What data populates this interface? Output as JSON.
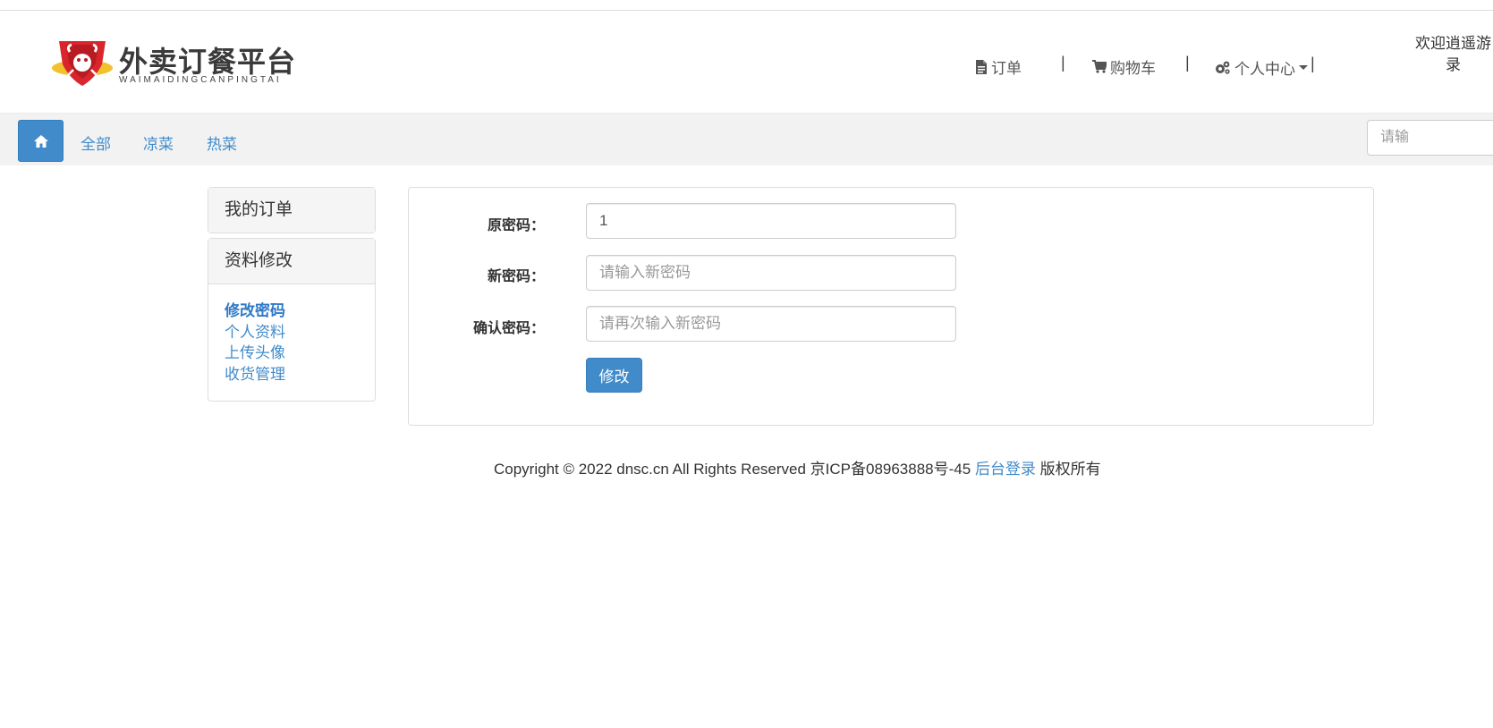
{
  "header": {
    "logo_cn": "外卖订餐平台",
    "logo_en": "WAIMAIDINGCANPINGTAI",
    "nav": {
      "orders": "订单",
      "cart": "购物车",
      "profile": "个人中心"
    },
    "separator": "|",
    "welcome_line1": "欢迎逍遥游",
    "welcome_line2": "录"
  },
  "navbar": {
    "links": [
      "全部",
      "凉菜",
      "热菜"
    ],
    "search_placeholder": "请输"
  },
  "sidebar": {
    "orders_title": "我的订单",
    "profile_title": "资料修改",
    "items": [
      "修改密码",
      "个人资料",
      "上传头像",
      "收货管理"
    ]
  },
  "form": {
    "old_password_label": "原密码：",
    "old_password_value": "1",
    "new_password_label": "新密码：",
    "new_password_placeholder": "请输入新密码",
    "confirm_password_label": "确认密码：",
    "confirm_password_placeholder": "请再次输入新密码",
    "submit_label": "修改"
  },
  "footer": {
    "copyright": "Copyright © 2022 dnsc.cn All Rights Reserved 京ICP备08963888号-45",
    "admin_link": "后台登录",
    "rights": "版权所有"
  },
  "colors": {
    "accent": "#428bca",
    "navbar_bg": "#f2f2f2",
    "logo_red": "#d9262c"
  }
}
